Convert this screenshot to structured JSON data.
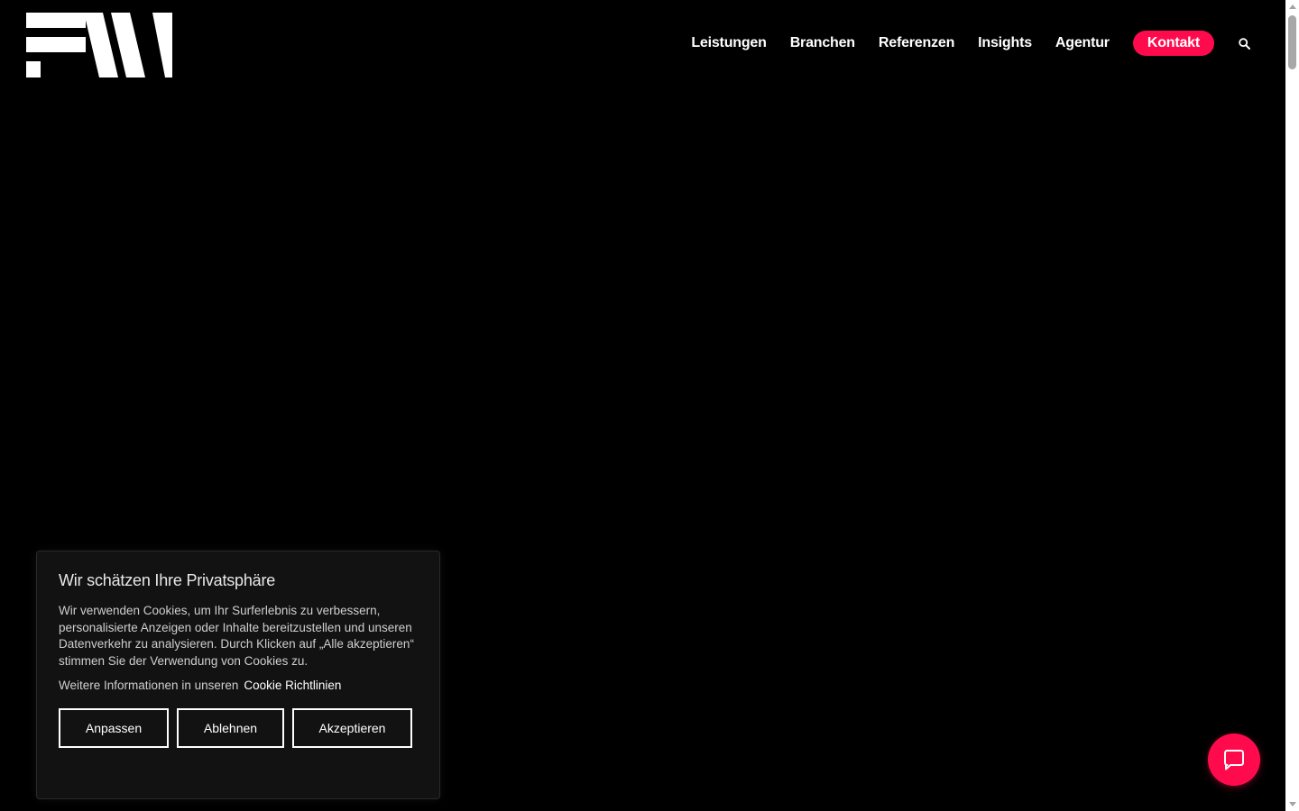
{
  "header": {
    "logo_icon": "fw-logo",
    "nav": {
      "items": [
        {
          "label": "Leistungen"
        },
        {
          "label": "Branchen"
        },
        {
          "label": "Referenzen"
        },
        {
          "label": "Insights"
        },
        {
          "label": "Agentur"
        }
      ],
      "contact_label": "Kontakt",
      "search_icon": "search-icon"
    }
  },
  "cookie_banner": {
    "title": "Wir schätzen Ihre Privatsphäre",
    "text": "Wir verwenden Cookies, um Ihr Surferlebnis zu verbessern, personalisierte Anzeigen oder Inhalte bereitzustellen und unseren Datenverkehr zu analysieren. Durch Klicken auf „Alle akzeptieren“ stimmen Sie der Verwendung von Cookies zu.",
    "more_info_text": "Weitere Informationen in unseren",
    "more_info_link": "Cookie Richtlinien",
    "buttons": {
      "customize": "Anpassen",
      "reject": "Ablehnen",
      "accept": "Akzeptieren"
    }
  },
  "chat": {
    "icon": "chat-bubble-icon"
  },
  "colors": {
    "accent": "#ff0b4d",
    "background": "#000000",
    "banner_bg": "#121212"
  }
}
